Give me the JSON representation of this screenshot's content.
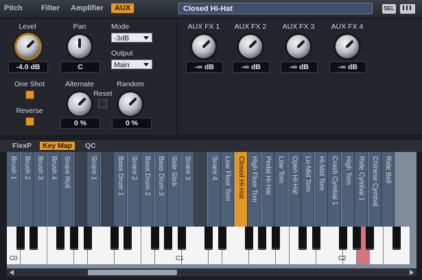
{
  "top_tabs": [
    "Pitch",
    "Filter",
    "Amplifier",
    "AUX"
  ],
  "preset_name": "Closed Hi-Hat",
  "sel_label": "SEL",
  "level": {
    "label": "Level",
    "value": "-4.0 dB"
  },
  "pan": {
    "label": "Pan",
    "value": "C"
  },
  "mode": {
    "label": "Mode",
    "value": "-3dB"
  },
  "output": {
    "label": "Output",
    "value": "Main"
  },
  "one_shot": {
    "label": "One Shot",
    "on": true
  },
  "reverse": {
    "label": "Reverse",
    "on": true
  },
  "alternate": {
    "label": "Alternate",
    "value": "0 %"
  },
  "reset_label": "Reset",
  "random": {
    "label": "Random",
    "value": "0 %"
  },
  "aux_fx": [
    {
      "label": "AUX FX 1",
      "value": "-∞ dB"
    },
    {
      "label": "AUX FX 2",
      "value": "-∞ dB"
    },
    {
      "label": "AUX FX 3",
      "value": "-∞ dB"
    },
    {
      "label": "AUX FX 4",
      "value": "-∞ dB"
    }
  ],
  "sub_tabs": [
    "FlexP",
    "Key Map",
    "QC"
  ],
  "keymap_pads": [
    "Brush 1",
    "Brush 2",
    "Brush 3",
    "Brush 4",
    "Snare Roll",
    "",
    "Snare 1",
    "",
    "Bass Drum 1",
    "Snare 2",
    "Bass Drum 2",
    "Bass Drum 3",
    "Side Stick",
    "Snare 3",
    "",
    "Snare 4",
    "Low Floor Tom",
    "Closed Hi-Hat",
    "High Floor Tom",
    "Pedal Hi-Hat",
    "Low Tom",
    "Open Hi-Hat",
    "Lo-Mid Tom",
    "Hi-Mid Tom",
    "Crash Cymbal 1",
    "High Tom",
    "Ride Cymbal 1",
    "Chinese Cymbal",
    "Ride Bell"
  ],
  "selected_pad": "Closed Hi-Hat",
  "octave_labels": [
    "C0",
    "C1",
    "C2"
  ],
  "accent_color": "#e69a24"
}
